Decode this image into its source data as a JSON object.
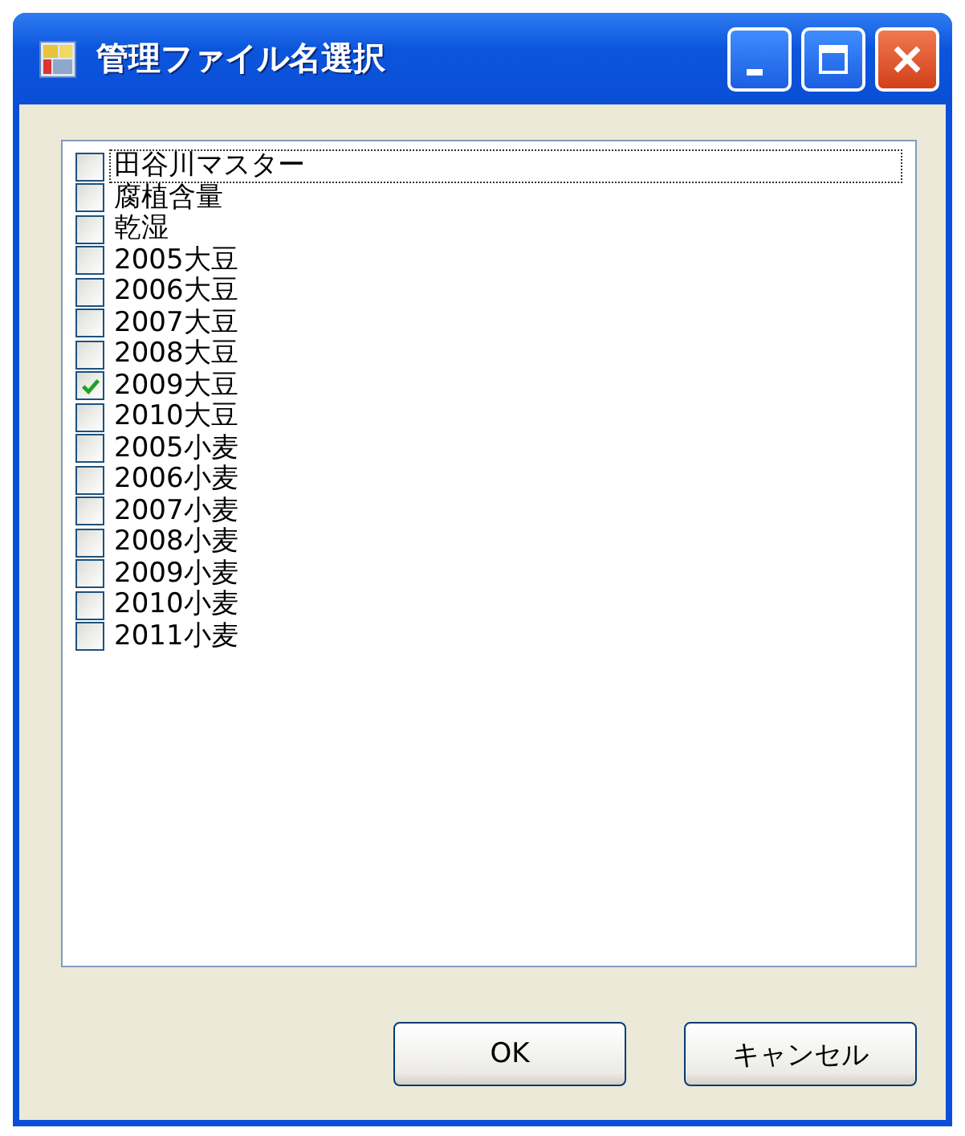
{
  "window": {
    "title": "管理ファイル名選択"
  },
  "items": [
    {
      "label": "田谷川マスター",
      "checked": false,
      "focused": true
    },
    {
      "label": "腐植含量",
      "checked": false,
      "focused": false
    },
    {
      "label": "乾湿",
      "checked": false,
      "focused": false
    },
    {
      "label": "2005大豆",
      "checked": false,
      "focused": false
    },
    {
      "label": "2006大豆",
      "checked": false,
      "focused": false
    },
    {
      "label": "2007大豆",
      "checked": false,
      "focused": false
    },
    {
      "label": "2008大豆",
      "checked": false,
      "focused": false
    },
    {
      "label": "2009大豆",
      "checked": true,
      "focused": false
    },
    {
      "label": "2010大豆",
      "checked": false,
      "focused": false
    },
    {
      "label": "2005小麦",
      "checked": false,
      "focused": false
    },
    {
      "label": "2006小麦",
      "checked": false,
      "focused": false
    },
    {
      "label": "2007小麦",
      "checked": false,
      "focused": false
    },
    {
      "label": "2008小麦",
      "checked": false,
      "focused": false
    },
    {
      "label": "2009小麦",
      "checked": false,
      "focused": false
    },
    {
      "label": "2010小麦",
      "checked": false,
      "focused": false
    },
    {
      "label": "2011小麦",
      "checked": false,
      "focused": false
    }
  ],
  "buttons": [
    "OK",
    "キャンセル"
  ]
}
